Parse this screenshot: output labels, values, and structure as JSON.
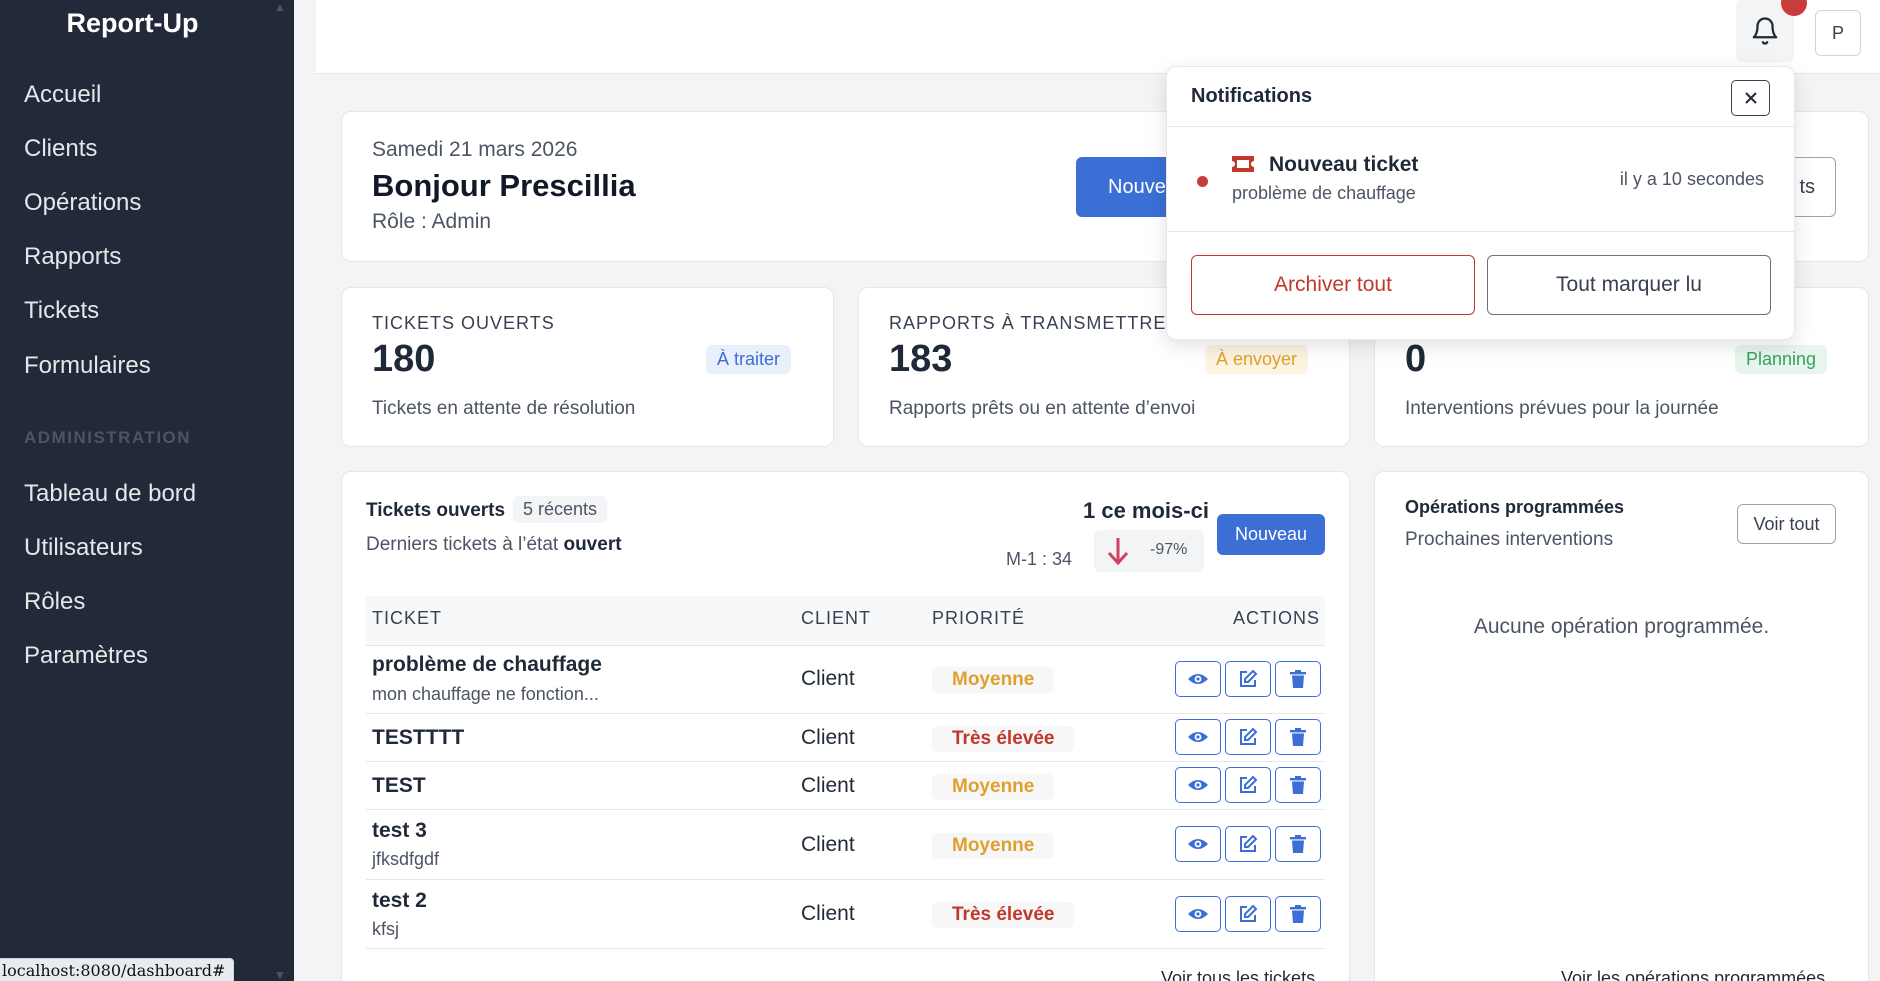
{
  "sidebar": {
    "brand": "Report-Up",
    "items": [
      {
        "label": "Accueil"
      },
      {
        "label": "Clients"
      },
      {
        "label": "Opérations"
      },
      {
        "label": "Rapports"
      },
      {
        "label": "Tickets"
      },
      {
        "label": "Formulaires"
      }
    ],
    "admin_section": "ADMINISTRATION",
    "admin_items": [
      {
        "label": "Tableau de bord"
      },
      {
        "label": "Utilisateurs"
      },
      {
        "label": "Rôles"
      },
      {
        "label": "Paramètres"
      }
    ]
  },
  "status_url": "localhost:8080/dashboard#",
  "topbar": {
    "avatar_initial": "P"
  },
  "greeting": {
    "date": "Samedi 21 mars 2026",
    "hello": "Bonjour Prescillia",
    "role": "Rôle : Admin",
    "new_button": "Nouveau",
    "outline_button": "ts"
  },
  "stats": [
    {
      "label": "TICKETS OUVERTS",
      "value": "180",
      "badge": "À traiter",
      "desc": "Tickets en attente de résolution",
      "badge_color": "#3b6fd6"
    },
    {
      "label": "RAPPORTS À TRANSMETTRE",
      "value": "183",
      "badge": "À envoyer",
      "desc": "Rapports prêts ou en attente d’envoi",
      "badge_color": "#e0a030"
    },
    {
      "label": "",
      "value": "0",
      "badge": "Planning",
      "desc": "Interventions prévues pour la journée",
      "badge_color": "#3aa060"
    }
  ],
  "tickets": {
    "title": "Tickets ouverts",
    "recent_badge": "5 récents",
    "subtitle_prefix": "Derniers tickets à l’état",
    "subtitle_state": "ouvert",
    "month_count": "1 ce mois-ci",
    "prev_month": "M-1 : 34",
    "trend": "-97%",
    "new_button": "Nouveau",
    "columns": {
      "ticket": "TICKET",
      "client": "CLIENT",
      "priority": "PRIORITÉ",
      "actions": "ACTIONS"
    },
    "rows": [
      {
        "title": "problème de chauffage",
        "sub": "mon chauffage ne fonction...",
        "client": "Client",
        "priority": "Moyenne",
        "level": "mid"
      },
      {
        "title": "TESTTTT",
        "sub": "",
        "client": "Client",
        "priority": "Très élevée",
        "level": "high"
      },
      {
        "title": "TEST",
        "sub": "",
        "client": "Client",
        "priority": "Moyenne",
        "level": "mid"
      },
      {
        "title": "test 3",
        "sub": "jfksdfgdf",
        "client": "Client",
        "priority": "Moyenne",
        "level": "mid"
      },
      {
        "title": "test 2",
        "sub": "kfsj",
        "client": "Client",
        "priority": "Très élevée",
        "level": "high"
      }
    ],
    "see_all": "Voir tous les tickets"
  },
  "operations": {
    "title": "Opérations programmées",
    "subtitle": "Prochaines interventions",
    "see_all_button": "Voir tout",
    "empty": "Aucune opération programmée.",
    "see_all_link": "Voir les opérations programmées"
  },
  "notifications": {
    "title": "Notifications",
    "item_title": "Nouveau ticket",
    "item_sub": "problème de chauffage",
    "item_time": "il y a 10 secondes",
    "archive_button": "Archiver tout",
    "mark_read_button": "Tout marquer lu"
  },
  "colors": {
    "sidebar": "#222a3a",
    "primary": "#3b6fd6",
    "danger": "#c0392b",
    "warning": "#e0a030",
    "success": "#3aa060"
  }
}
